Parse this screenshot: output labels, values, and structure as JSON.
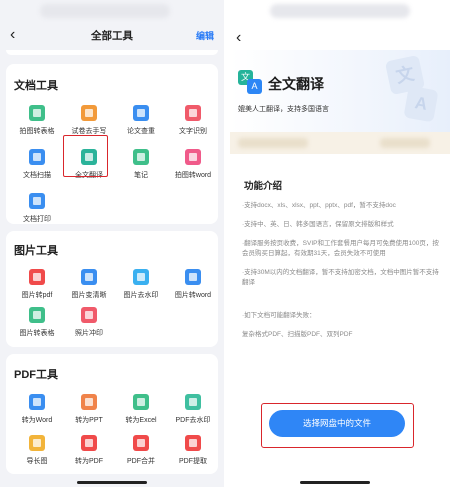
{
  "left": {
    "title": "全部工具",
    "edit": "编辑",
    "back": "‹",
    "sections": [
      {
        "title": "文档工具",
        "tools": [
          {
            "label": "拍图转表格",
            "color": "#3fbf8a"
          },
          {
            "label": "试卷去手写",
            "color": "#f29a3a"
          },
          {
            "label": "论文查重",
            "color": "#3a8ef0"
          },
          {
            "label": "文字识别",
            "color": "#f05a6a"
          },
          {
            "label": "文档扫描",
            "color": "#3a8ef0"
          },
          {
            "label": "全文翻译",
            "color": "#2bb39a"
          },
          {
            "label": "笔记",
            "color": "#3fbf8a"
          },
          {
            "label": "拍图转word",
            "color": "#f05a8a"
          },
          {
            "label": "文档打印",
            "color": "#3a8ef0"
          }
        ]
      },
      {
        "title": "图片工具",
        "tools": [
          {
            "label": "图片转pdf",
            "color": "#f04a4a"
          },
          {
            "label": "图片变清晰",
            "color": "#3a8ef0"
          },
          {
            "label": "图片去水印",
            "color": "#3ab0f0"
          },
          {
            "label": "图片转word",
            "color": "#3a8ef0"
          },
          {
            "label": "图片转表格",
            "color": "#3fbf8a"
          },
          {
            "label": "照片冲印",
            "color": "#f05a6a"
          }
        ]
      },
      {
        "title": "PDF工具",
        "tools": [
          {
            "label": "转为Word",
            "color": "#3a8ef0"
          },
          {
            "label": "转为PPT",
            "color": "#f0834a"
          },
          {
            "label": "转为Excel",
            "color": "#3fbf8a"
          },
          {
            "label": "PDF去水印",
            "color": "#3fbfa0"
          },
          {
            "label": "导长图",
            "color": "#f2b43a"
          },
          {
            "label": "转为PDF",
            "color": "#f04a4a"
          },
          {
            "label": "PDF合并",
            "color": "#f04a4a"
          },
          {
            "label": "PDF提取",
            "color": "#f04a4a"
          }
        ]
      }
    ]
  },
  "right": {
    "back": "‹",
    "icon_a": "文",
    "icon_b": "A",
    "title": "全文翻译",
    "subtitle": "媲美人工翻译，支持多国语言",
    "section_title": "功能介绍",
    "intro": [
      "·支持docx、xls、xlsx、ppt、pptx、pdf，暂不支持doc",
      "·支持中、英、日、韩多国语言，保留原文排版和样式",
      "·翻译服务按页收费，SVIP和工作套餐用户每月可免费使用100页，按会员购买日算起，有效期31天，会员失效不可使用",
      "·支持30M以内的文档翻译，暂不支持加密文档，文档中图片暂不支持翻译"
    ],
    "fail_title": "·如下文档可能翻译失败：",
    "fail_list": "复杂格式PDF、扫描版PDF、双列PDF",
    "cta": "选择网盘中的文件"
  },
  "accent": "#2f86f6",
  "highlight": "#d9262c"
}
